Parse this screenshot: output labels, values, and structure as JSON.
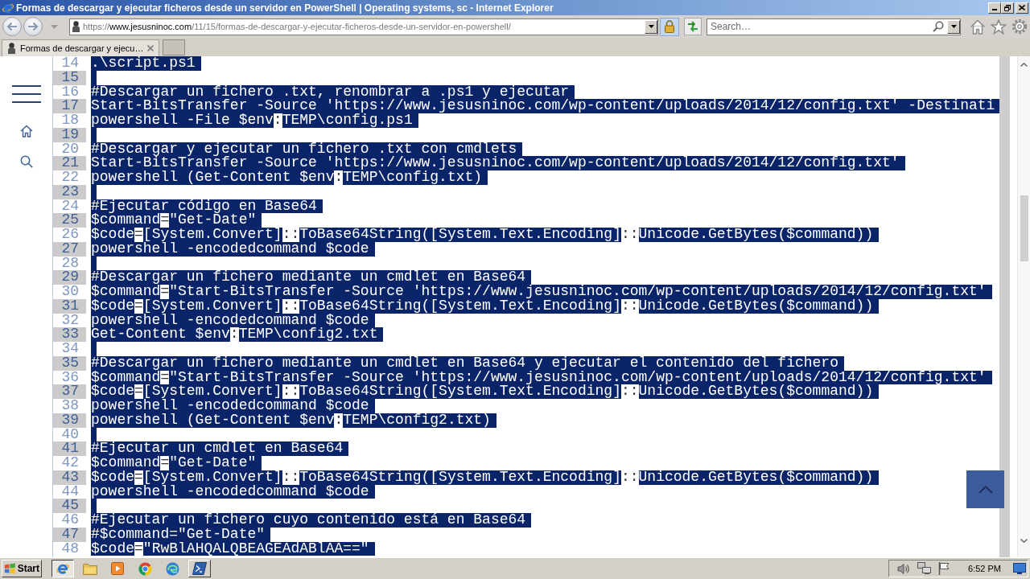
{
  "window": {
    "title": "Formas de descargar y ejecutar ficheros desde un servidor en PowerShell | Operating systems, sc - Internet Explorer"
  },
  "address_bar": {
    "scheme": "https://",
    "host": "www.jesusninoc.com",
    "path": "/11/15/formas-de-descargar-y-ejecutar-ficheros-desde-un-servidor-en-powershell/"
  },
  "search": {
    "placeholder": "Search…"
  },
  "tabs": [
    {
      "label": "Formas de descargar y ejecu…",
      "selected": true
    }
  ],
  "code": {
    "lines": [
      {
        "number": "14",
        "shaded": false,
        "break_selected": true,
        "segments": [
          {
            "text": ".\\script.ps1",
            "selected": true
          }
        ]
      },
      {
        "number": "15",
        "shaded": true,
        "break_selected": true
      },
      {
        "number": "16",
        "shaded": false,
        "break_selected": true,
        "segments": [
          {
            "text": "#Descargar un fichero .txt, renombrar a .ps1 y ejecutar",
            "selected": true
          }
        ]
      },
      {
        "number": "17",
        "shaded": true,
        "break_selected": true,
        "segments": [
          {
            "text": "Start-BitsTransfer -Source 'https://www.jesusninoc.com/wp-content/uploads/2014/12/config.txt' -Destinati",
            "selected": true
          }
        ]
      },
      {
        "number": "18",
        "shaded": false,
        "break_selected": true,
        "segments": [
          {
            "text": "powershell -File $env",
            "selected": true
          },
          {
            "text": ":",
            "selected": false
          },
          {
            "text": "TEMP\\config.ps1",
            "selected": true
          }
        ]
      },
      {
        "number": "19",
        "shaded": true,
        "break_selected": true
      },
      {
        "number": "20",
        "shaded": false,
        "break_selected": true,
        "segments": [
          {
            "text": "#Descargar y ejecutar un fichero .txt con cmdlets",
            "selected": true
          }
        ]
      },
      {
        "number": "21",
        "shaded": true,
        "break_selected": true,
        "segments": [
          {
            "text": "Start-BitsTransfer -Source 'https://www.jesusninoc.com/wp-content/uploads/2014/12/config.txt'",
            "selected": true
          }
        ]
      },
      {
        "number": "22",
        "shaded": false,
        "break_selected": true,
        "segments": [
          {
            "text": "powershell (Get-Content $env",
            "selected": true
          },
          {
            "text": ":",
            "selected": false
          },
          {
            "text": "TEMP\\config.txt)",
            "selected": true
          }
        ]
      },
      {
        "number": "23",
        "shaded": true,
        "break_selected": true
      },
      {
        "number": "24",
        "shaded": false,
        "break_selected": true,
        "segments": [
          {
            "text": "#Ejecutar código en Base64",
            "selected": true
          }
        ]
      },
      {
        "number": "25",
        "shaded": true,
        "break_selected": true,
        "segments": [
          {
            "text": "$command",
            "selected": true
          },
          {
            "text": "=",
            "selected": false
          },
          {
            "text": "\"Get-Date\"",
            "selected": true
          }
        ]
      },
      {
        "number": "26",
        "shaded": false,
        "break_selected": true,
        "segments": [
          {
            "text": "$code",
            "selected": true
          },
          {
            "text": "=",
            "selected": false
          },
          {
            "text": "[System.Convert]",
            "selected": true
          },
          {
            "text": "::",
            "selected": false
          },
          {
            "text": "ToBase64String([System.Text.Encoding]",
            "selected": true
          },
          {
            "text": "::",
            "selected": false
          },
          {
            "text": "Unicode.GetBytes($command))",
            "selected": true
          }
        ]
      },
      {
        "number": "27",
        "shaded": true,
        "break_selected": true,
        "segments": [
          {
            "text": "powershell -encodedcommand $code",
            "selected": true
          }
        ]
      },
      {
        "number": "28",
        "shaded": false,
        "break_selected": true
      },
      {
        "number": "29",
        "shaded": true,
        "break_selected": true,
        "segments": [
          {
            "text": "#Descargar un fichero mediante un cmdlet en Base64",
            "selected": true
          }
        ]
      },
      {
        "number": "30",
        "shaded": false,
        "break_selected": true,
        "segments": [
          {
            "text": "$command",
            "selected": true
          },
          {
            "text": "=",
            "selected": false
          },
          {
            "text": "\"Start-BitsTransfer -Source 'https://www.jesusninoc.com/wp-content/uploads/2014/12/config.txt'",
            "selected": true
          }
        ]
      },
      {
        "number": "31",
        "shaded": true,
        "break_selected": true,
        "segments": [
          {
            "text": "$code",
            "selected": true
          },
          {
            "text": "=",
            "selected": false
          },
          {
            "text": "[System.Convert]",
            "selected": true
          },
          {
            "text": "::",
            "selected": false
          },
          {
            "text": "ToBase64String([System.Text.Encoding]",
            "selected": true
          },
          {
            "text": "::",
            "selected": false
          },
          {
            "text": "Unicode.GetBytes($command))",
            "selected": true
          }
        ]
      },
      {
        "number": "32",
        "shaded": false,
        "break_selected": true,
        "segments": [
          {
            "text": "powershell -encodedcommand $code",
            "selected": true
          }
        ]
      },
      {
        "number": "33",
        "shaded": true,
        "break_selected": true,
        "segments": [
          {
            "text": "Get-Content $env",
            "selected": true
          },
          {
            "text": ":",
            "selected": false
          },
          {
            "text": "TEMP\\config2.txt",
            "selected": true
          }
        ]
      },
      {
        "number": "34",
        "shaded": false,
        "break_selected": true
      },
      {
        "number": "35",
        "shaded": true,
        "break_selected": true,
        "segments": [
          {
            "text": "#Descargar un fichero mediante un cmdlet en Base64 y ejecutar el contenido del fichero",
            "selected": true
          }
        ]
      },
      {
        "number": "36",
        "shaded": false,
        "break_selected": true,
        "segments": [
          {
            "text": "$command",
            "selected": true
          },
          {
            "text": "=",
            "selected": false
          },
          {
            "text": "\"Start-BitsTransfer -Source 'https://www.jesusninoc.com/wp-content/uploads/2014/12/config.txt'",
            "selected": true
          }
        ]
      },
      {
        "number": "37",
        "shaded": true,
        "break_selected": true,
        "segments": [
          {
            "text": "$code",
            "selected": true
          },
          {
            "text": "=",
            "selected": false
          },
          {
            "text": "[System.Convert]",
            "selected": true
          },
          {
            "text": "::",
            "selected": false
          },
          {
            "text": "ToBase64String([System.Text.Encoding]",
            "selected": true
          },
          {
            "text": "::",
            "selected": false
          },
          {
            "text": "Unicode.GetBytes($command))",
            "selected": true
          }
        ]
      },
      {
        "number": "38",
        "shaded": false,
        "break_selected": true,
        "segments": [
          {
            "text": "powershell -encodedcommand $code",
            "selected": true
          }
        ]
      },
      {
        "number": "39",
        "shaded": true,
        "break_selected": true,
        "segments": [
          {
            "text": "powershell (Get-Content $env",
            "selected": true
          },
          {
            "text": ":",
            "selected": false
          },
          {
            "text": "TEMP\\config2.txt)",
            "selected": true
          }
        ]
      },
      {
        "number": "40",
        "shaded": false,
        "break_selected": true
      },
      {
        "number": "41",
        "shaded": true,
        "break_selected": true,
        "segments": [
          {
            "text": "#Ejecutar un cmdlet en Base64",
            "selected": true
          }
        ]
      },
      {
        "number": "42",
        "shaded": false,
        "break_selected": true,
        "segments": [
          {
            "text": "$command",
            "selected": true
          },
          {
            "text": "=",
            "selected": false
          },
          {
            "text": "\"Get-Date\"",
            "selected": true
          }
        ]
      },
      {
        "number": "43",
        "shaded": true,
        "break_selected": true,
        "segments": [
          {
            "text": "$code",
            "selected": true
          },
          {
            "text": "=",
            "selected": false
          },
          {
            "text": "[System.Convert]",
            "selected": true
          },
          {
            "text": "::",
            "selected": false
          },
          {
            "text": "ToBase64String([System.Text.Encoding]",
            "selected": true
          },
          {
            "text": "::",
            "selected": false
          },
          {
            "text": "Unicode.GetBytes($command))",
            "selected": true
          }
        ]
      },
      {
        "number": "44",
        "shaded": false,
        "break_selected": true,
        "segments": [
          {
            "text": "powershell -encodedcommand $code",
            "selected": true
          }
        ]
      },
      {
        "number": "45",
        "shaded": true,
        "break_selected": true
      },
      {
        "number": "46",
        "shaded": false,
        "break_selected": true,
        "segments": [
          {
            "text": "#Ejecutar un fichero cuyo contenido está en Base64",
            "selected": true
          }
        ]
      },
      {
        "number": "47",
        "shaded": true,
        "break_selected": true,
        "segments": [
          {
            "text": "#$command=\"Get-Date\"",
            "selected": true
          }
        ]
      },
      {
        "number": "48",
        "shaded": false,
        "break_selected": true,
        "segments": [
          {
            "text": "$code",
            "selected": true
          },
          {
            "text": "=",
            "selected": false
          },
          {
            "text": "\"RwBlAHQALQBEAGEAdABlAA==\"",
            "selected": true
          }
        ]
      }
    ]
  },
  "taskbar": {
    "start": "Start",
    "buttons": [
      {
        "open": true,
        "selected": true
      },
      {
        "open": false,
        "selected": false
      },
      {
        "open": false,
        "selected": false
      },
      {
        "open": false,
        "selected": false
      },
      {
        "open": false,
        "selected": false
      },
      {
        "open": true,
        "selected": false
      }
    ],
    "clock": "6:52 PM"
  }
}
